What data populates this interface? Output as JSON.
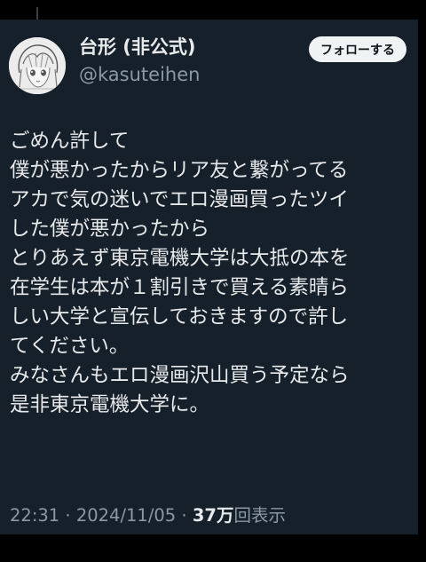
{
  "tweet": {
    "author": {
      "display_name": "台形 (非公式)",
      "handle": "@kasuteihen"
    },
    "follow_label": "フォローする",
    "lines": [
      "ごめん許して",
      "僕が悪かったからリア友と繋がってる",
      "アカで気の迷いでエロ漫画買ったツイ",
      "した僕が悪かったから",
      "とりあえず東京電機大学は大抵の本を",
      "在学生は本が１割引きで買える素晴ら",
      "しい大学と宣伝しておきますので許し",
      "てください。",
      "みなさんもエロ漫画沢山買う予定なら",
      "是非東京電機大学に。"
    ],
    "meta": {
      "time": "22:31",
      "separator": "·",
      "date": "2024/11/05",
      "views_count": "37万",
      "views_label": "回表示"
    }
  },
  "colors": {
    "card_background": "#15202b",
    "primary_text": "#e7e9ea",
    "secondary_text": "#8b98a5",
    "follow_button_bg": "#eff3f4"
  }
}
